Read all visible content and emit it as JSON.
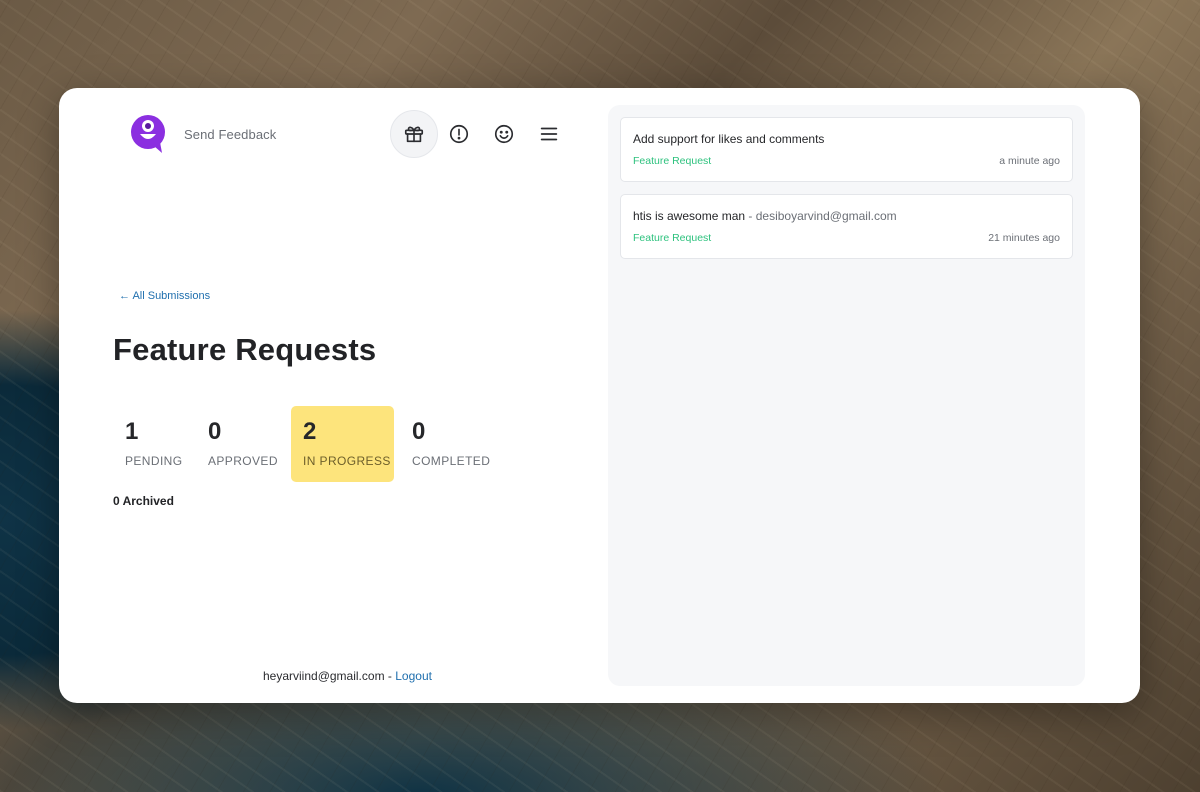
{
  "header": {
    "brand_label": "Send Feedback",
    "nav_icons": [
      "gift-icon",
      "alert-icon",
      "smile-icon",
      "menu-icon"
    ],
    "active_icon": "gift-icon"
  },
  "back_link": "← All Submissions",
  "page_title": "Feature Requests",
  "stats": [
    {
      "value": "1",
      "label": "PENDING",
      "highlighted": false
    },
    {
      "value": "0",
      "label": "APPROVED",
      "highlighted": false
    },
    {
      "value": "2",
      "label": "IN PROGRESS",
      "highlighted": true
    },
    {
      "value": "0",
      "label": "COMPLETED",
      "highlighted": false
    }
  ],
  "archived": "0 Archived",
  "footer": {
    "email": "heyarviind@gmail.com",
    "separator": "-",
    "logout_label": "Logout"
  },
  "feed": [
    {
      "title": "Add support for likes and comments",
      "author": "",
      "tag": "Feature Request",
      "time": "a minute ago"
    },
    {
      "title": "htis is awesome man",
      "author": "- desiboyarvind@gmail.com",
      "tag": "Feature Request",
      "time": "21 minutes ago"
    }
  ],
  "colors": {
    "accent": "#1f6fae",
    "brand": "#8b2fe0",
    "highlight": "#fde47c",
    "tag_green": "#2ec27e"
  }
}
